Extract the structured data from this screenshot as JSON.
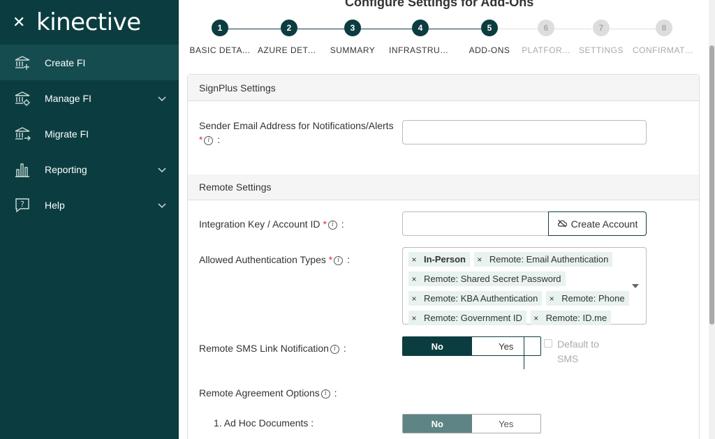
{
  "sidebar": {
    "brand": "kinective",
    "items": [
      {
        "label": "Create FI",
        "active": true
      },
      {
        "label": "Manage FI",
        "expandable": true
      },
      {
        "label": "Migrate FI"
      },
      {
        "label": "Reporting",
        "expandable": true
      },
      {
        "label": "Help",
        "expandable": true
      }
    ]
  },
  "page": {
    "title": "Configure Settings for Add-Ons"
  },
  "steps": [
    {
      "num": "1",
      "label": "BASIC DETA...",
      "state": "done"
    },
    {
      "num": "2",
      "label": "AZURE DETA...",
      "state": "done"
    },
    {
      "num": "3",
      "label": "SUMMARY",
      "state": "done"
    },
    {
      "num": "4",
      "label": "INFRASTRUCT...",
      "state": "done"
    },
    {
      "num": "5",
      "label": "ADD-ONS",
      "state": "current"
    },
    {
      "num": "6",
      "label": "PLATFOR...",
      "state": "future"
    },
    {
      "num": "7",
      "label": "SETTINGS",
      "state": "future"
    },
    {
      "num": "8",
      "label": "CONFIRMATI...",
      "state": "future"
    }
  ],
  "signplus": {
    "header": "SignPlus Settings",
    "sender_email_label": "Sender Email Address for Notifications/Alerts",
    "required_mark": "*",
    "colon": ":",
    "sender_email_value": ""
  },
  "remote": {
    "header": "Remote Settings",
    "integration_key_label": "Integration Key / Account ID",
    "integration_key_value": "",
    "create_account_label": "Create Account",
    "auth_types_label": "Allowed Authentication Types",
    "auth_types": [
      {
        "label": "In-Person",
        "bold": true
      },
      {
        "label": "Remote: Email Authentication"
      },
      {
        "label": "Remote: Shared Secret Password"
      },
      {
        "label": "Remote: KBA Authentication"
      },
      {
        "label": "Remote: Phone"
      },
      {
        "label": "Remote: Government ID"
      },
      {
        "label": "Remote: ID.me"
      }
    ],
    "sms_link_label": "Remote SMS Link Notification",
    "sms_no": "No",
    "sms_yes": "Yes",
    "sms_selected": "No",
    "default_sms_label": "Default to SMS",
    "agreement_label": "Remote Agreement Options",
    "adhoc_label": "1. Ad Hoc Documents :",
    "adhoc_no": "No",
    "adhoc_yes": "Yes",
    "adhoc_selected": "No"
  },
  "colors": {
    "sidebar_bg": "#0b3d40",
    "accent": "#0b3d40",
    "chip_bg": "#e8f2ee",
    "required": "#d32f2f"
  }
}
